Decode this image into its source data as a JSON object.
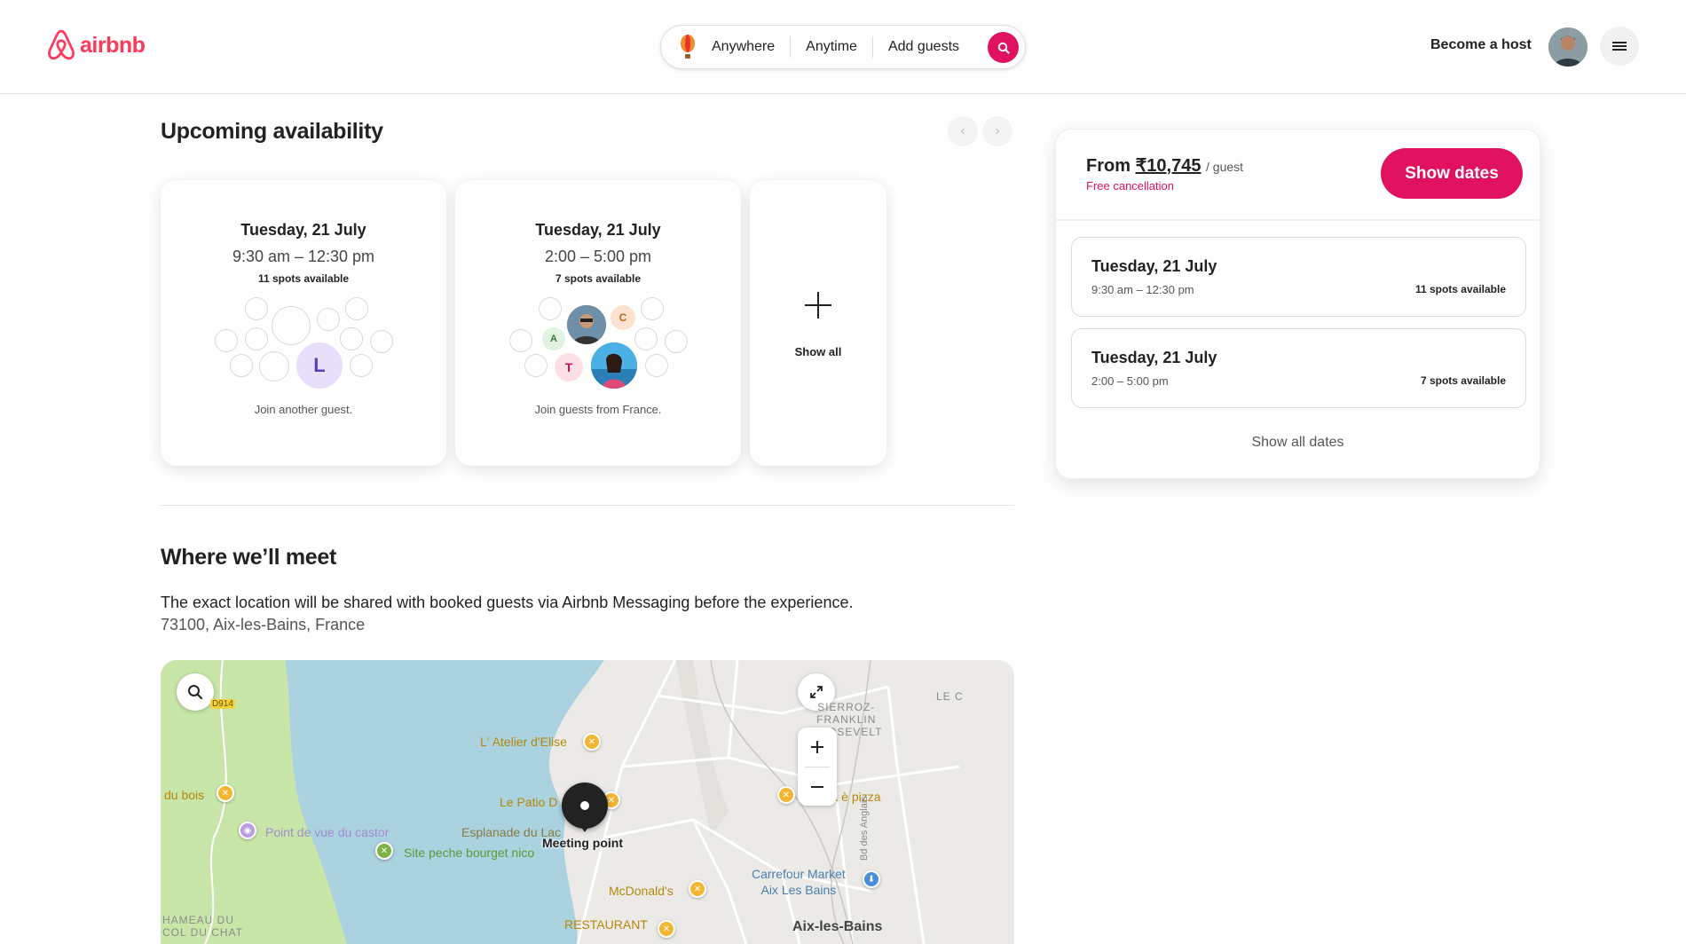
{
  "header": {
    "logo_text": "airbnb",
    "search": {
      "where": "Anywhere",
      "when": "Anytime",
      "who": "Add guests"
    },
    "become_host": "Become a host"
  },
  "availability": {
    "title": "Upcoming availability",
    "cards": [
      {
        "date": "Tuesday, 21 July",
        "time": "9:30 am – 12:30 pm",
        "spots": "11 spots available",
        "footer": "Join another guest.",
        "initial": "L"
      },
      {
        "date": "Tuesday, 21 July",
        "time": "2:00 – 5:00 pm",
        "spots": "7 spots available",
        "footer": "Join guests from France.",
        "initials": [
          "A",
          "C",
          "T"
        ]
      }
    ],
    "show_all": "Show all"
  },
  "meet": {
    "title": "Where we’ll meet",
    "description": "The exact location will be shared with booked guests via Airbnb Messaging before the experience.",
    "address": "73100, Aix-les-Bains, France"
  },
  "map": {
    "labels": {
      "road": "D914",
      "atelier": "L' Atelier d'Elise",
      "dubois": "du bois",
      "patio": "Le Patio D",
      "vita": "La vita è pizza",
      "castor": "Point de vue du castor",
      "esplanade": "Esplanade du Lac",
      "meeting": "Meeting point",
      "peche": "Site peche bourget nico",
      "carrefour": "Carrefour Market\nAix Les Bains",
      "mcd": "McDonald's",
      "restaurant": "RESTAURANT",
      "aix": "Aix-les-Bains",
      "sierroz": "SIERROZ-\nFRANKLIN\nROOSEVELT",
      "hameau": "HAMEAU DU\nCOL DU CHAT",
      "lec": "LE C",
      "bd": "Bd des Anglais"
    }
  },
  "booking": {
    "from": "From",
    "price": "₹10,745",
    "per": "/ guest",
    "free_cancel": "Free cancellation",
    "button": "Show dates",
    "slots": [
      {
        "date": "Tuesday, 21 July",
        "time": "9:30 am – 12:30 pm",
        "spots": "11 spots available"
      },
      {
        "date": "Tuesday, 21 July",
        "time": "2:00 – 5:00 pm",
        "spots": "7 spots available"
      }
    ],
    "show_all": "Show all dates"
  },
  "colors": {
    "brand": "#ff385c",
    "accent": "#e0115f",
    "water": "#aad3df",
    "land": "#eceae6",
    "park": "#c8e6a8"
  }
}
